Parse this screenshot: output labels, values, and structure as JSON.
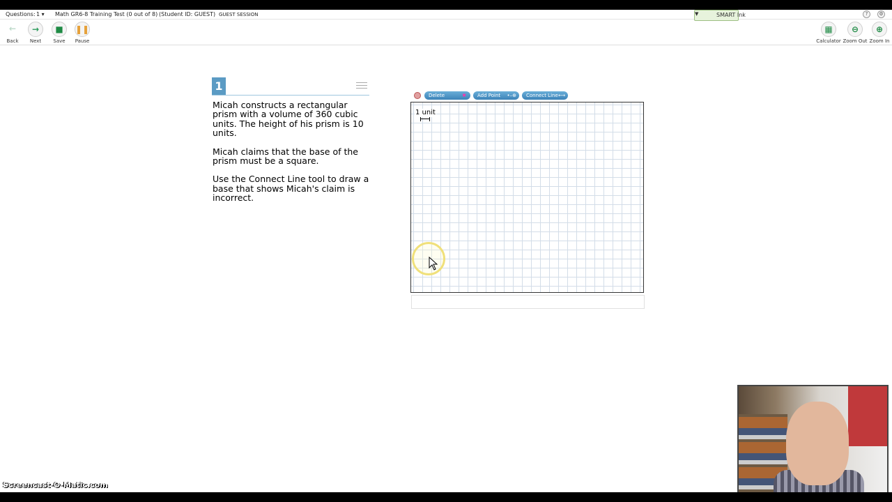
{
  "infobar": {
    "questions_label": "Questions:",
    "question_selected": "1",
    "test_title": "Math GR6-8 Training Test (0 out of 8)",
    "student_id": "(Student ID: GUEST)",
    "session": "GUEST SESSION",
    "smart_ink": "SMART Ink"
  },
  "toolbar": {
    "back": "Back",
    "next": "Next",
    "save": "Save",
    "pause": "Pause",
    "calculator": "Calculator",
    "zoom_out": "Zoom Out",
    "zoom_in": "Zoom In"
  },
  "question": {
    "number": "1",
    "paragraphs": [
      "Micah constructs a rectangular prism with a volume of 360 cubic units. The height of his prism is 10 units.",
      "Micah claims that the base of the prism must be a square.",
      "Use the Connect Line tool to draw a base that shows Micah's claim is incorrect."
    ]
  },
  "graph": {
    "delete_label": "Delete",
    "add_point_label": "Add Point",
    "connect_line_label": "Connect Line",
    "unit_label": "1 unit"
  },
  "colors": {
    "accent_blue": "#5b9bc4",
    "button_blue": "#3c83b8",
    "grid_line": "#d3dde8"
  },
  "watermark": "Screencast-O-Matic.com"
}
